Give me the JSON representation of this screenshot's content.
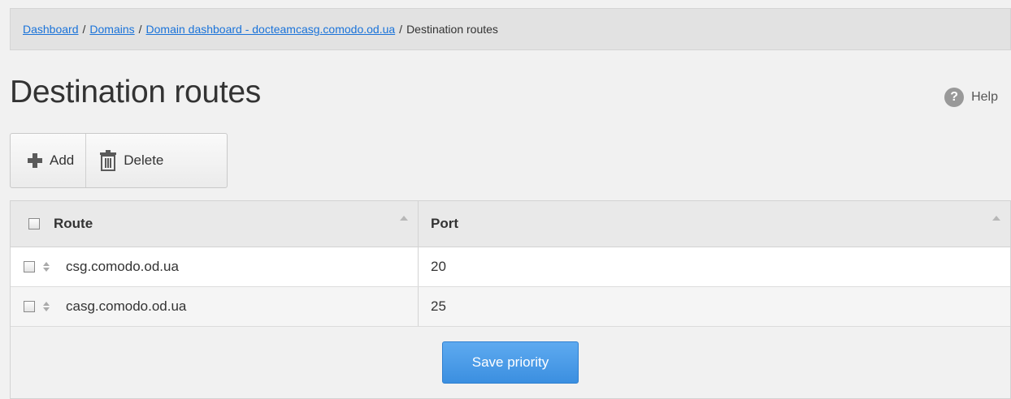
{
  "breadcrumb": {
    "items": [
      {
        "label": "Dashboard",
        "link": true
      },
      {
        "label": "Domains",
        "link": true
      },
      {
        "label": "Domain dashboard - docteamcasg.comodo.od.ua",
        "link": true
      },
      {
        "label": "Destination routes",
        "link": false
      }
    ],
    "separator": "/"
  },
  "page": {
    "title": "Destination routes"
  },
  "help": {
    "label": "Help",
    "icon": "question-circle-icon",
    "glyph": "?"
  },
  "toolbar": {
    "add_label": "Add",
    "add_icon": "plus-icon",
    "delete_label": "Delete",
    "delete_icon": "trash-icon"
  },
  "table": {
    "columns": [
      "Route",
      "Port"
    ],
    "rows": [
      {
        "route": "csg.comodo.od.ua",
        "port": "20"
      },
      {
        "route": "casg.comodo.od.ua",
        "port": "25"
      }
    ]
  },
  "footer": {
    "save_label": "Save priority"
  },
  "colors": {
    "link": "#1a73d9",
    "primary_button": "#3b8fe0",
    "background": "#f1f1f1"
  }
}
